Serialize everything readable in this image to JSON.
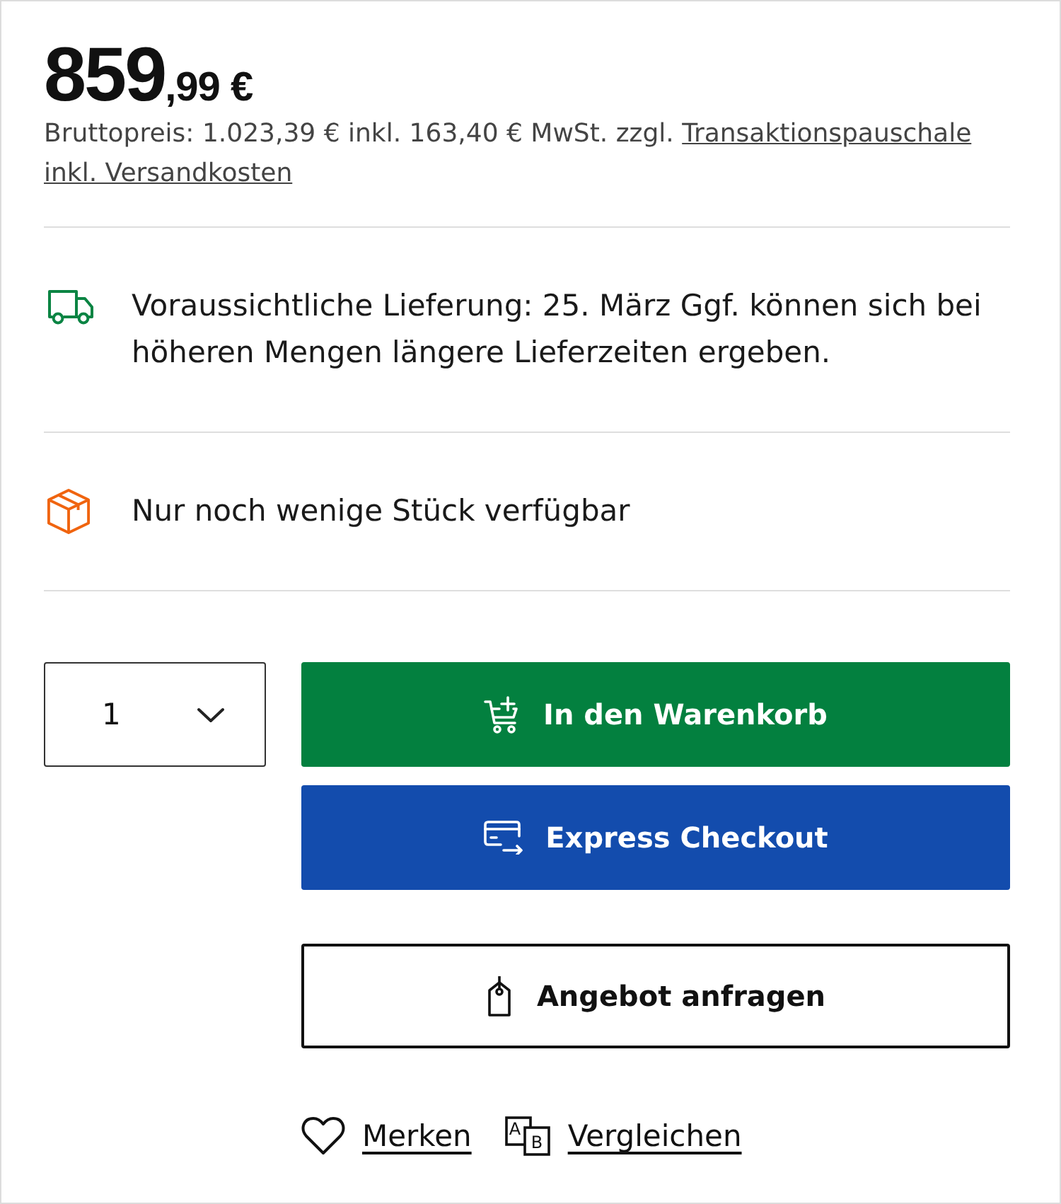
{
  "price": {
    "integer": "859",
    "fraction": ",99 €"
  },
  "price_note": {
    "text": "Bruttopreis: 1.023,39 € inkl. 163,40 € MwSt. zzgl.",
    "links": [
      "Transaktionspauschale",
      "inkl. Versandkosten"
    ]
  },
  "info_rows": [
    {
      "kind": "delivery",
      "color": "#0a8443",
      "text": "Voraussichtliche Lieferung: 25. März Ggf. können sich bei höheren Mengen längere Lieferzeiten ergeben."
    },
    {
      "kind": "stock",
      "color": "#f0640f",
      "text": "Nur noch wenige Stück verfügbar"
    }
  ],
  "quantity": {
    "value": "1"
  },
  "buttons": [
    {
      "kind": "cart",
      "label": "In den Warenkorb"
    },
    {
      "kind": "express",
      "label": "Express Checkout"
    },
    {
      "kind": "quote",
      "label": "Angebot anfragen"
    }
  ],
  "actions": [
    {
      "kind": "wishlist",
      "label": "Merken"
    },
    {
      "kind": "compare",
      "label": "Vergleichen",
      "icon_letters": [
        "A",
        "B"
      ]
    }
  ]
}
